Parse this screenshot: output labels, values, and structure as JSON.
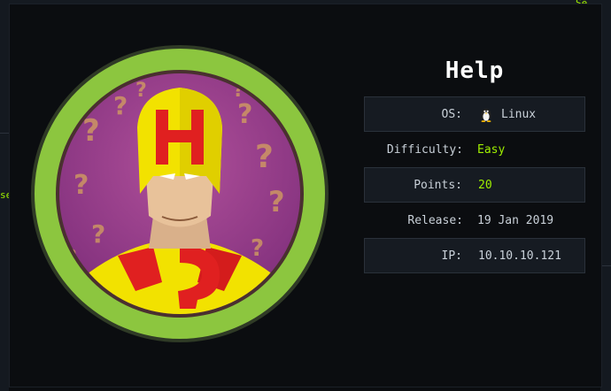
{
  "background": {
    "fragment_left": "se",
    "fragment_top_right": "Se"
  },
  "machine": {
    "name": "Help",
    "avatar": "help-superhero-avatar",
    "rows": [
      {
        "label": "OS:",
        "value": "Linux",
        "icon": "tux-penguin-icon"
      },
      {
        "label": "Difficulty:",
        "value": "Easy"
      },
      {
        "label": "Points:",
        "value": "20"
      },
      {
        "label": "Release:",
        "value": "19 Jan 2019"
      },
      {
        "label": "IP:",
        "value": "10.10.10.121"
      }
    ]
  },
  "colors": {
    "accent": "#9fef00",
    "difficulty_easy": "#9fef00",
    "ring": "#8cc63f",
    "panel": "#161b22",
    "background": "#0b0d10"
  }
}
